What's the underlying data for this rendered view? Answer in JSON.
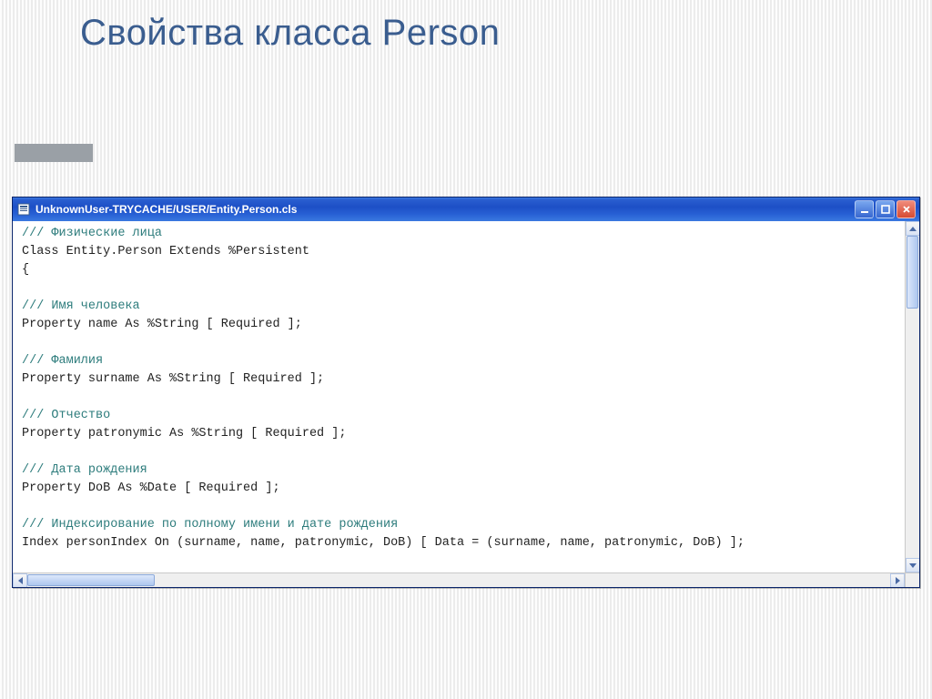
{
  "slide": {
    "title": "Свойства класса Person"
  },
  "window": {
    "title": "UnknownUser-TRYCACHE/USER/Entity.Person.cls"
  },
  "code": {
    "lines": [
      {
        "text": "/// Физические лица",
        "cls": "comment"
      },
      {
        "text": "Class Entity.Person Extends %Persistent",
        "cls": ""
      },
      {
        "text": "{",
        "cls": ""
      },
      {
        "text": "",
        "cls": ""
      },
      {
        "text": "/// Имя человека",
        "cls": "comment"
      },
      {
        "text": "Property name As %String [ Required ];",
        "cls": ""
      },
      {
        "text": "",
        "cls": ""
      },
      {
        "text": "/// Фамилия",
        "cls": "comment"
      },
      {
        "text": "Property surname As %String [ Required ];",
        "cls": ""
      },
      {
        "text": "",
        "cls": ""
      },
      {
        "text": "/// Отчество",
        "cls": "comment"
      },
      {
        "text": "Property patronymic As %String [ Required ];",
        "cls": ""
      },
      {
        "text": "",
        "cls": ""
      },
      {
        "text": "/// Дата рождения",
        "cls": "comment"
      },
      {
        "text": "Property DoB As %Date [ Required ];",
        "cls": ""
      },
      {
        "text": "",
        "cls": ""
      },
      {
        "text": "/// Индексирование по полному имени и дате рождения",
        "cls": "comment"
      },
      {
        "text": "Index personIndex On (surname, name, patronymic, DoB) [ Data = (surname, name, patronymic, DoB) ];",
        "cls": ""
      },
      {
        "text": "",
        "cls": ""
      },
      {
        "text": "}",
        "cls": ""
      }
    ]
  }
}
